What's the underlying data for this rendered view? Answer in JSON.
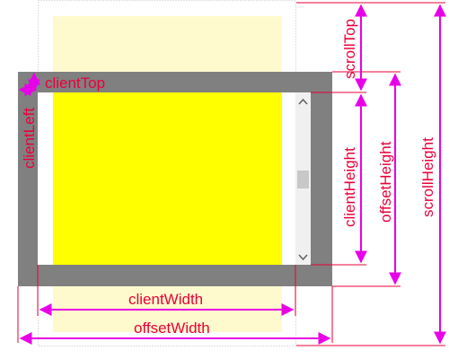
{
  "diagram": {
    "labels": {
      "client_top": "clientTop",
      "client_left": "clientLeft",
      "scroll_top": "scrollTop",
      "client_height": "clientHeight",
      "offset_height": "offsetHeight",
      "scroll_height": "scrollHeight",
      "client_width": "clientWidth",
      "offset_width": "offsetWidth"
    },
    "colors": {
      "label_text": "#e8003a",
      "measure_arrow": "#e800e8",
      "guide_line": "#e8003a",
      "border": "#808080",
      "content": "#ffff00",
      "hidden_content": "#fffacd",
      "scrollbar_track": "#f0f0f0",
      "scrollbar_thumb": "#c8c8c8",
      "scrollbar_arrow": "#606060",
      "scroll_area_outline": "#c0c0c0"
    },
    "icons": {
      "scroll_up": "chevron-up-icon",
      "scroll_down": "chevron-down-icon"
    }
  }
}
